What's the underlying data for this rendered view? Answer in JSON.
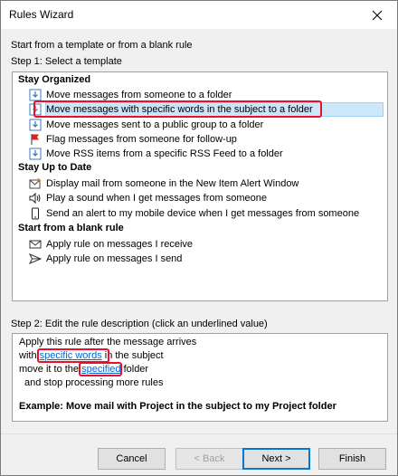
{
  "window": {
    "title": "Rules Wizard"
  },
  "intro": "Start from a template or from a blank rule",
  "step1": {
    "label": "Step 1: Select a template",
    "groups": [
      {
        "header": "Stay Organized",
        "items": [
          {
            "label": "Move messages from someone to a folder",
            "icon": "move-folder-icon"
          },
          {
            "label": "Move messages with specific words in the subject to a folder",
            "icon": "move-folder-icon",
            "selected": true
          },
          {
            "label": "Move messages sent to a public group to a folder",
            "icon": "move-folder-icon"
          },
          {
            "label": "Flag messages from someone for follow-up",
            "icon": "flag-icon"
          },
          {
            "label": "Move RSS items from a specific RSS Feed to a folder",
            "icon": "move-folder-icon"
          }
        ]
      },
      {
        "header": "Stay Up to Date",
        "items": [
          {
            "label": "Display mail from someone in the New Item Alert Window",
            "icon": "alert-window-icon"
          },
          {
            "label": "Play a sound when I get messages from someone",
            "icon": "speaker-icon"
          },
          {
            "label": "Send an alert to my mobile device when I get messages from someone",
            "icon": "mobile-device-icon"
          }
        ]
      },
      {
        "header": "Start from a blank rule",
        "items": [
          {
            "label": "Apply rule on messages I receive",
            "icon": "envelope-icon"
          },
          {
            "label": "Apply rule on messages I send",
            "icon": "send-icon"
          }
        ]
      }
    ]
  },
  "step2": {
    "label": "Step 2: Edit the rule description (click an underlined value)",
    "line1": "Apply this rule after the message arrives",
    "line2_pre": "with ",
    "line2_link": "specific words",
    "line2_post": " in the subject",
    "line3_pre": "move it to the ",
    "line3_link": "specified",
    "line3_post": " folder",
    "line4": "and stop processing more rules",
    "example": "Example: Move mail with Project in the subject to my Project folder"
  },
  "buttons": {
    "cancel": "Cancel",
    "back": "< Back",
    "next": "Next >",
    "finish": "Finish"
  },
  "colors": {
    "selection": "#cde8fb",
    "highlight": "#e8112d",
    "link": "#0066cc",
    "accent": "#0078d7"
  }
}
